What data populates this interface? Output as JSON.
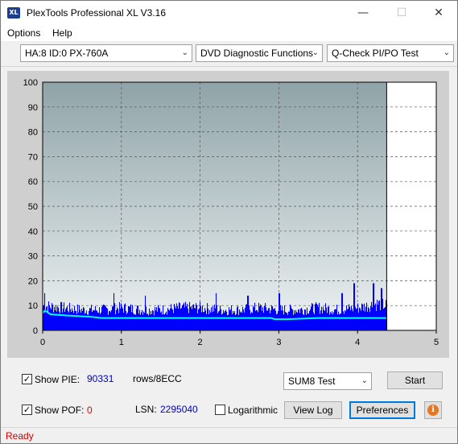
{
  "window": {
    "title": "PlexTools Professional XL V3.16",
    "icon_text": "XL",
    "minimize": "—",
    "maximize": "☐",
    "close": "✕"
  },
  "menu": {
    "options": "Options",
    "help": "Help"
  },
  "toolbar": {
    "drive": "HA:8 ID:0  PX-760A",
    "function": "DVD Diagnostic Functions",
    "test": "Q-Check PI/PO Test"
  },
  "chart_data": {
    "type": "bar",
    "x_ticks": [
      "0",
      "1",
      "2",
      "3",
      "4",
      "5"
    ],
    "y_ticks": [
      "0",
      "10",
      "20",
      "30",
      "40",
      "50",
      "60",
      "70",
      "80",
      "90",
      "100"
    ],
    "xlim": [
      0,
      5
    ],
    "ylim": [
      0,
      100
    ],
    "grid": true,
    "data_end_x": 4.37,
    "series": [
      {
        "color": "#0000ff",
        "description_x": [
          0,
          0.25,
          0.5,
          0.75,
          1.0,
          1.25,
          1.5,
          1.75,
          2.0,
          2.25,
          2.5,
          2.75,
          3.0,
          3.25,
          3.5,
          3.75,
          4.0,
          4.25,
          4.37
        ],
        "values": [
          12,
          11,
          10,
          10,
          11,
          10,
          10,
          11,
          11,
          10,
          10,
          11,
          10,
          10,
          11,
          10,
          11,
          13,
          12
        ],
        "peaks": [
          {
            "x": 0.02,
            "y": 15
          },
          {
            "x": 0.9,
            "y": 15
          },
          {
            "x": 1.3,
            "y": 14
          },
          {
            "x": 2.2,
            "y": 15
          },
          {
            "x": 2.6,
            "y": 14
          },
          {
            "x": 3.0,
            "y": 15
          },
          {
            "x": 3.8,
            "y": 15
          },
          {
            "x": 3.95,
            "y": 19
          },
          {
            "x": 4.2,
            "y": 19
          },
          {
            "x": 4.3,
            "y": 17
          }
        ]
      },
      {
        "color": "#00ffff",
        "x": [
          0,
          0.03,
          0.1,
          0.3,
          0.6,
          0.75,
          1.0,
          2.0,
          2.9,
          2.95,
          3.1,
          3.5,
          4.0,
          4.37
        ],
        "values": [
          7,
          8,
          6.5,
          6,
          5.5,
          5,
          5,
          5,
          5,
          4.5,
          4.5,
          5,
          5,
          5
        ]
      }
    ]
  },
  "bottom": {
    "show_pie_label": "Show PIE:",
    "pie_value": "90331",
    "rows_label": "rows/8ECC",
    "show_pof_label": "Show POF:",
    "pof_value": "0",
    "lsn_label": "LSN:",
    "lsn_value": "2295040",
    "logarithmic_label": "Logarithmic",
    "sum8_select": "SUM8 Test",
    "start_button": "Start",
    "view_log_button": "View Log",
    "preferences_button": "Preferences",
    "info_button": "i",
    "check_mark": "✓"
  },
  "status": {
    "text": "Ready"
  },
  "colors": {
    "plot_bg_top": "#8fa4a8",
    "plot_bg_bottom": "#eef2f3",
    "pie_value": "#0000c0",
    "pof_value": "#e00000",
    "status_text": "#d00000"
  }
}
